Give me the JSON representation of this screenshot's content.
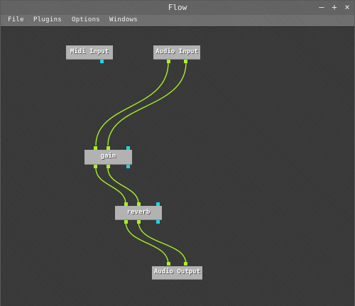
{
  "window": {
    "title": "Flow",
    "controls": {
      "minimize": "—",
      "maximize": "+",
      "close": "×"
    }
  },
  "menu": {
    "items": [
      "File",
      "Plugins",
      "Options",
      "Windows"
    ]
  },
  "nodes": {
    "midi_input": "Midi Input",
    "audio_input": "Audio Input",
    "gain": "gain",
    "reverb": "reverb",
    "audio_output": "Audio Output"
  },
  "colors": {
    "audio_port": "#a7f025",
    "midi_port": "#19d6e6",
    "wire": "#a7f025",
    "node": "#b2b2b2",
    "background": "#3b3b3b"
  }
}
